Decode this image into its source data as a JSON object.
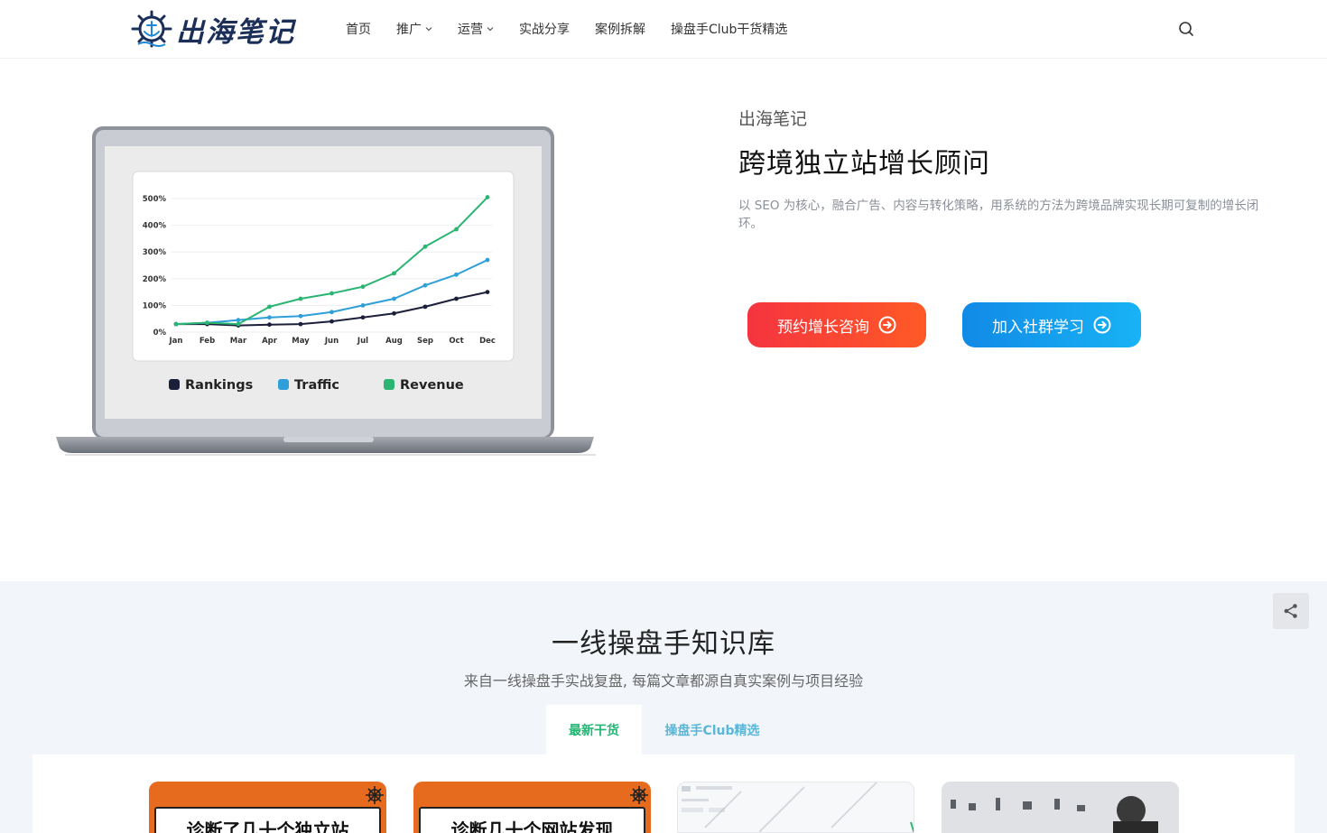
{
  "header": {
    "logo_text": "出海笔记",
    "nav": [
      {
        "label": "首页",
        "dropdown": false
      },
      {
        "label": "推广",
        "dropdown": true
      },
      {
        "label": "运营",
        "dropdown": true
      },
      {
        "label": "实战分享",
        "dropdown": false
      },
      {
        "label": "案例拆解",
        "dropdown": false
      },
      {
        "label": "操盘手Club干货精选",
        "dropdown": false
      }
    ],
    "search_icon": "search-icon"
  },
  "hero": {
    "subtitle": "出海笔记",
    "title": "跨境独立站增长顾问",
    "description": "以 SEO 为核心，融合广告、内容与转化策略，用系统的方法为跨境品牌实现长期可复制的增长闭环。",
    "primary_button": "预约增长咨询",
    "secondary_button": "加入社群学习",
    "colors": {
      "primary": "#f5343f",
      "secondary": "#118ae6"
    }
  },
  "chart_data": {
    "type": "line",
    "categories": [
      "Jan",
      "Feb",
      "Mar",
      "Apr",
      "May",
      "Jun",
      "Jul",
      "Aug",
      "Sep",
      "Oct",
      "Dec"
    ],
    "y_ticks": [
      "0%",
      "100%",
      "200%",
      "300%",
      "400%",
      "500%"
    ],
    "ylim": [
      0,
      500
    ],
    "series": [
      {
        "name": "Rankings",
        "color": "#1b1f3a",
        "values": [
          30,
          30,
          25,
          28,
          30,
          40,
          55,
          70,
          95,
          125,
          150
        ]
      },
      {
        "name": "Traffic",
        "color": "#2e9fd8",
        "values": [
          30,
          35,
          45,
          55,
          60,
          75,
          100,
          125,
          175,
          215,
          270
        ]
      },
      {
        "name": "Revenue",
        "color": "#2bb573",
        "values": [
          30,
          35,
          30,
          95,
          125,
          145,
          170,
          220,
          320,
          385,
          505
        ]
      }
    ],
    "legend_position": "bottom",
    "grid": true
  },
  "knowledge": {
    "title": "一线操盘手知识库",
    "subtitle": "来自一线操盘手实战复盘, 每篇文章都源自真实案例与项目经验",
    "tabs": [
      {
        "label": "最新干货",
        "active": true
      },
      {
        "label": "操盘手Club精选",
        "active": false
      }
    ],
    "cards": [
      {
        "title": "诊断了几十个独立站"
      },
      {
        "title": "诊断几十个网站发现"
      },
      {
        "title": ""
      },
      {
        "title": ""
      }
    ]
  }
}
